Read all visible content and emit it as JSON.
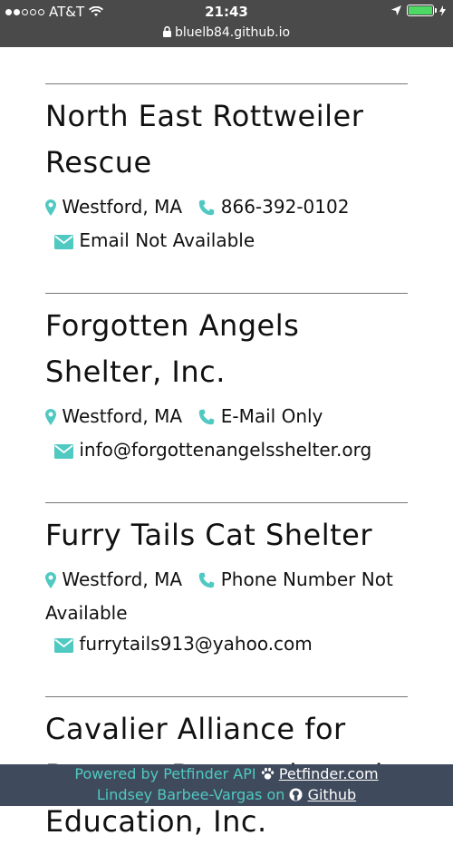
{
  "status_bar": {
    "carrier": "AT&T",
    "time": "21:43",
    "battery_color": "#4cd964"
  },
  "browser": {
    "url": "bluelb84.github.io"
  },
  "accent_color": "#4fc9c1",
  "shelters": [
    {
      "name": "North East Rottweiler Rescue",
      "location": "Westford, MA",
      "phone": "866-392-0102",
      "email": "Email Not Available"
    },
    {
      "name": "Forgotten Angels Shelter, Inc.",
      "location": "Westford, MA",
      "phone": "E-Mail Only",
      "email": "info@forgottenangelsshelter.org"
    },
    {
      "name": "Furry Tails Cat Shelter",
      "location": "Westford, MA",
      "phone": "Phone Number Not Available",
      "email": "furrytails913@yahoo.com"
    },
    {
      "name": "Cavalier Alliance for Rescue, Research, and Education, Inc."
    }
  ],
  "footer": {
    "powered_by": "Powered by Petfinder API",
    "petfinder_link": "Petfinder.com",
    "author": "Lindsey Barbee-Vargas on",
    "github_link": "Github"
  }
}
